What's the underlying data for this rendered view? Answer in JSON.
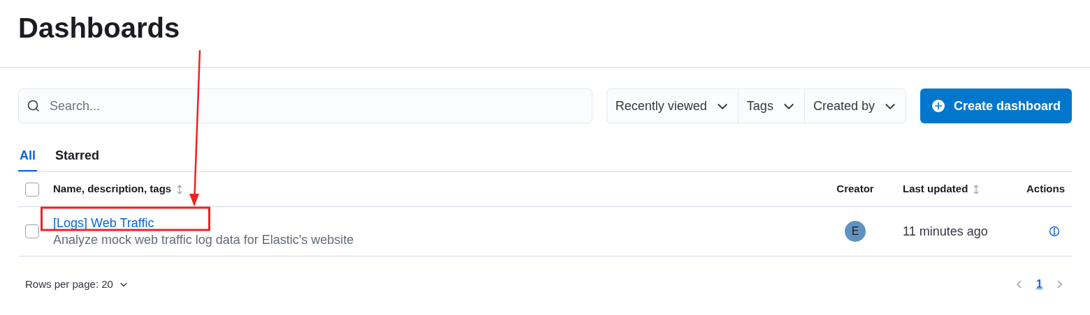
{
  "page": {
    "title": "Dashboards"
  },
  "search": {
    "placeholder": "Search..."
  },
  "filters": [
    {
      "label": "Recently viewed"
    },
    {
      "label": "Tags"
    },
    {
      "label": "Created by"
    }
  ],
  "create_button": {
    "label": "Create dashboard"
  },
  "tabs": [
    {
      "label": "All",
      "selected": true
    },
    {
      "label": "Starred",
      "selected": false
    }
  ],
  "table": {
    "select_all_checked": false,
    "columns": [
      {
        "label": "Name, description, tags",
        "sortable": true
      },
      {
        "label": "Creator",
        "sortable": false
      },
      {
        "label": "Last updated",
        "sortable": true
      },
      {
        "label": "Actions",
        "sortable": false
      }
    ],
    "rows": [
      {
        "title": "[Logs] Web Traffic",
        "description": "Analyze mock web traffic log data for Elastic's website",
        "creator": "E",
        "updated": "11 minutes ago",
        "checked": false,
        "highlighted": true
      }
    ]
  },
  "footer": {
    "rows_per_page": "Rows per page: 20",
    "pages": [
      {
        "label": "1",
        "selected": true
      }
    ]
  }
}
